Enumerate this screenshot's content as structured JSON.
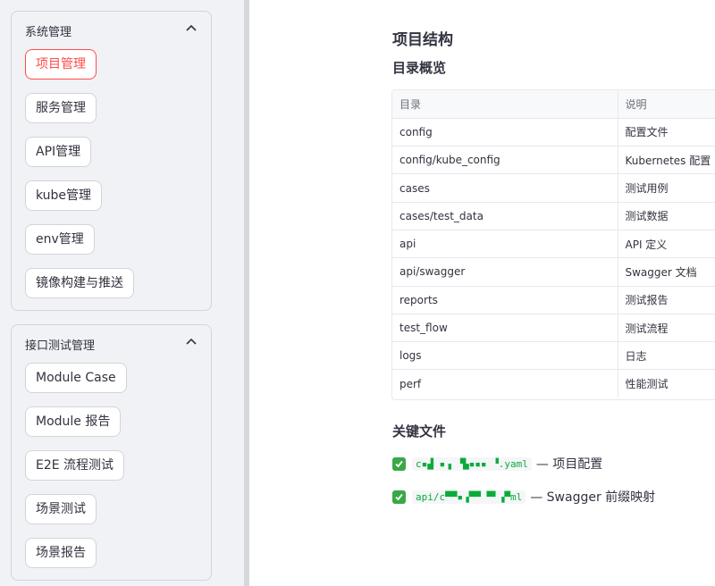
{
  "sidebar": {
    "groups": [
      {
        "title": "系统管理",
        "items": [
          "项目管理",
          "服务管理",
          "API管理",
          "kube管理",
          "env管理",
          "镜像构建与推送"
        ],
        "active_index": 0
      },
      {
        "title": "接口测试管理",
        "items": [
          "Module Case",
          "Module 报告",
          "E2E 流程测试",
          "场景测试",
          "场景报告"
        ]
      }
    ]
  },
  "main": {
    "title": "项目结构",
    "overview_title": "目录概览",
    "table": {
      "headers": [
        "目录",
        "说明"
      ],
      "rows": [
        [
          "config",
          "配置文件"
        ],
        [
          "config/kube_config",
          "Kubernetes 配置"
        ],
        [
          "cases",
          "测试用例"
        ],
        [
          "cases/test_data",
          "测试数据"
        ],
        [
          "api",
          "API 定义"
        ],
        [
          "api/swagger",
          "Swagger 文档"
        ],
        [
          "reports",
          "测试报告"
        ],
        [
          "test_flow",
          "测试流程"
        ],
        [
          "logs",
          "日志"
        ],
        [
          "perf",
          "性能测试"
        ]
      ]
    },
    "key_files_title": "关键文件",
    "key_files": [
      {
        "path": "c▪▟ ▪▗ ▝▙▪▪▪ ▝.yaml",
        "desc": "— 项目配置"
      },
      {
        "path": "api/c▀▀▪▗▀▀ ▀▘▗▀ml",
        "desc": "— Swagger 前缀映射"
      }
    ]
  },
  "colors": {
    "accent": "#ff4b4b",
    "sidebar_bg": "#f0f2f6",
    "check_green": "#3aa845",
    "code_green": "#09ab3b"
  }
}
